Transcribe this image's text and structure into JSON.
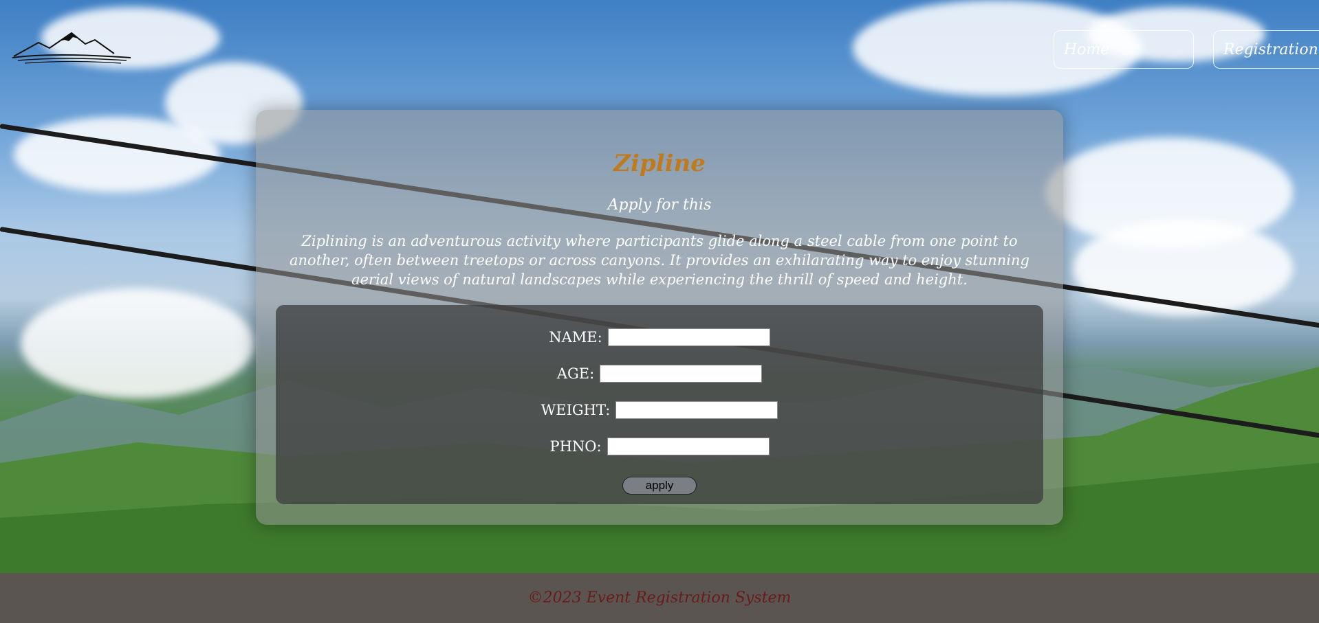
{
  "nav": {
    "home_label": "Home",
    "registration_label": "Registration"
  },
  "event": {
    "title": "Zipline",
    "subtitle": "Apply for this",
    "description": "Ziplining is an adventurous activity where participants glide along a steel cable from one point to another, often between treetops or across canyons. It provides an exhilarating way to enjoy stunning aerial views of natural landscapes while experiencing the thrill of speed and height."
  },
  "form": {
    "name_label": "NAME:",
    "age_label": "AGE:",
    "weight_label": "WEIGHT:",
    "phno_label": "PHNO:",
    "name_value": "",
    "age_value": "",
    "weight_value": "",
    "phno_value": "",
    "apply_label": "apply"
  },
  "footer": {
    "text": "©2023 Event Registration System"
  },
  "colors": {
    "title": "#c07a1c",
    "footer_bg": "#5a5550",
    "footer_text": "#6b1a1a"
  },
  "icons": {
    "logo": "mountain-logo-icon"
  }
}
